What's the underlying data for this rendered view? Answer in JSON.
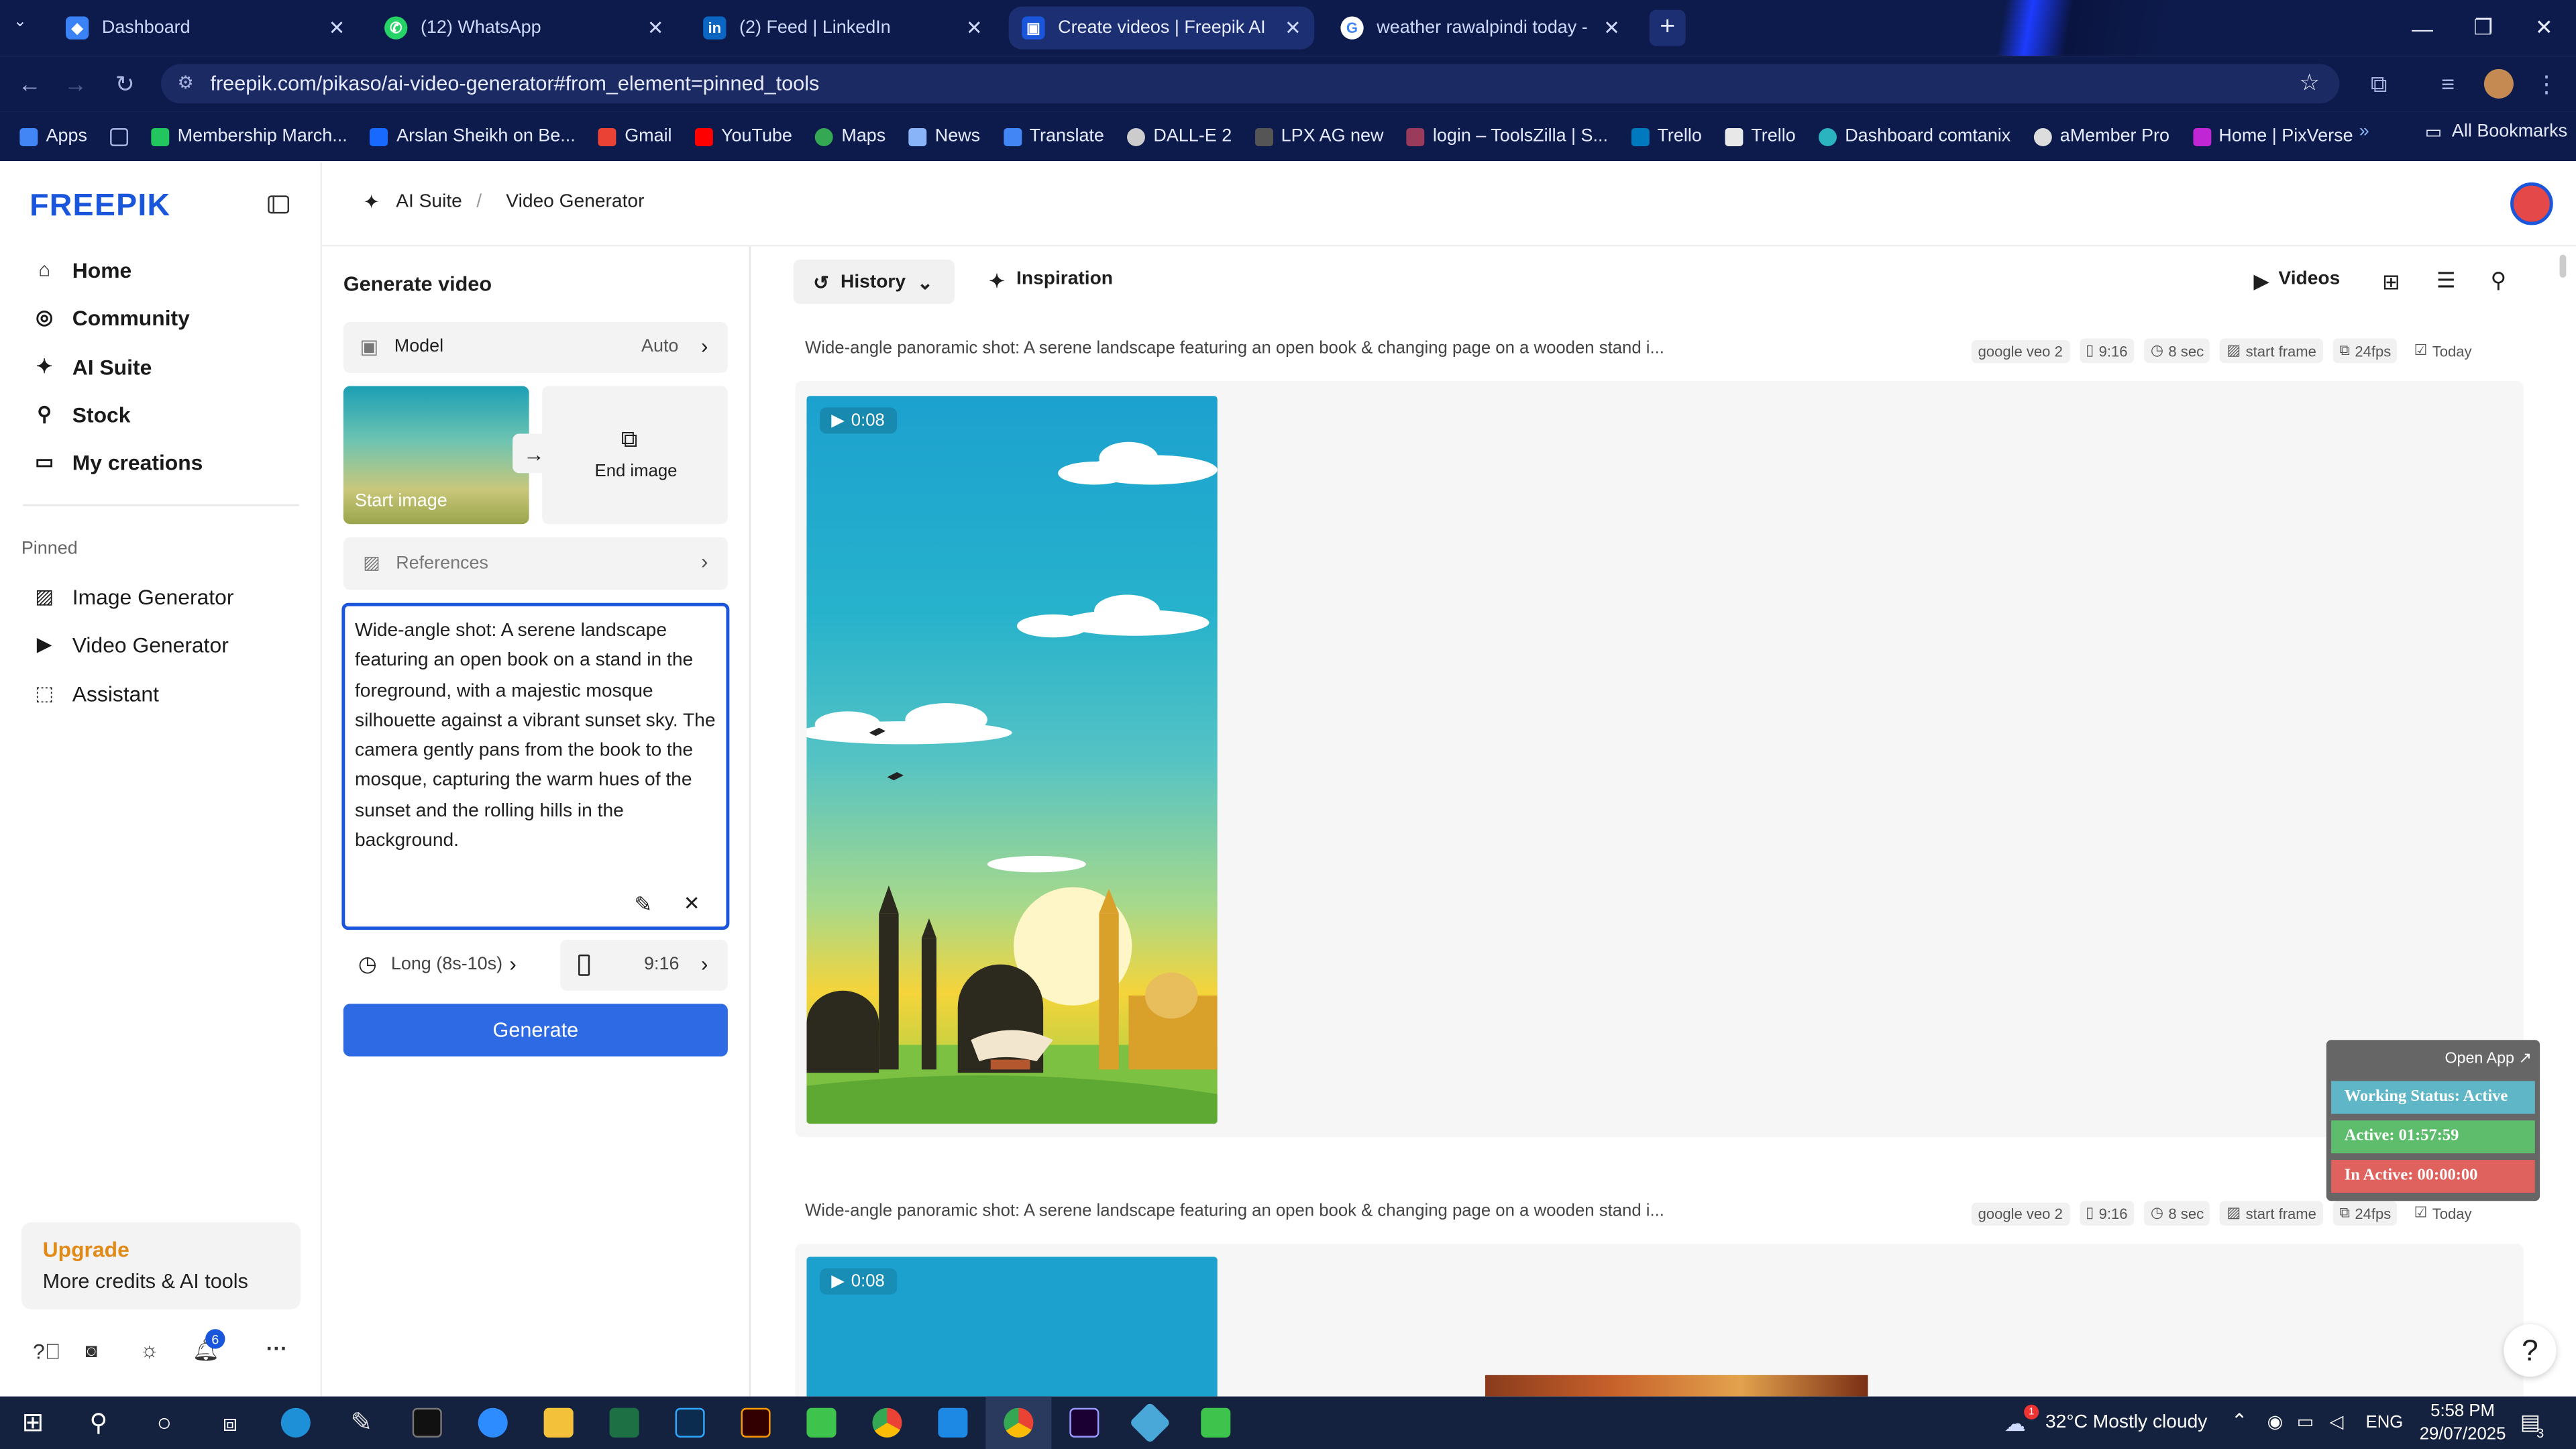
{
  "browser": {
    "tabs": [
      {
        "title": "Dashboard",
        "color": "#3b82f6"
      },
      {
        "title": "(12) WhatsApp",
        "color": "#25d366"
      },
      {
        "title": "(2) Feed | LinkedIn",
        "color": "#0a66c2"
      },
      {
        "title": "Create videos | Freepik AI",
        "color": "#1a56db"
      },
      {
        "title": "weather rawalpindi today - Goo",
        "color": "#ffffff"
      }
    ],
    "url": "freepik.com/pikaso/ai-video-generator#from_element=pinned_tools",
    "bookmarks": [
      "Apps",
      "Membership March...",
      "Arslan Sheikh on Be...",
      "Gmail",
      "YouTube",
      "Maps",
      "News",
      "Translate",
      "DALL-E 2",
      "LPX AG new",
      "login – ToolsZilla | S...",
      "Trello",
      "Trello",
      "Dashboard comtanix",
      "aMember Pro",
      "Home | PixVerse"
    ],
    "all_bookmarks": "All Bookmarks"
  },
  "header": {
    "logo": "FREEPIK",
    "breadcrumb_1": "AI Suite",
    "breadcrumb_sep": "/",
    "breadcrumb_2": "Video Generator"
  },
  "sidebar": {
    "items": [
      "Home",
      "Community",
      "AI Suite",
      "Stock",
      "My creations"
    ],
    "pinned_label": "Pinned",
    "pinned": [
      "Image Generator",
      "Video Generator",
      "Assistant"
    ],
    "upgrade_title": "Upgrade",
    "upgrade_sub": "More credits & AI tools",
    "notif_count": "6"
  },
  "generator": {
    "title": "Generate video",
    "model_label": "Model",
    "model_value": "Auto",
    "start_image": "Start image",
    "end_image": "End image",
    "references": "References",
    "prompt": "Wide-angle shot: A serene landscape featuring an open book on a stand in the foreground, with a majestic mosque silhouette against a vibrant sunset sky. The camera gently pans from the book to the mosque, capturing the warm hues of the sunset and the rolling hills in the background.",
    "duration": "Long (8s-10s)",
    "ratio": "9:16",
    "generate": "Generate"
  },
  "content": {
    "history": "History",
    "inspiration": "Inspiration",
    "videos": "Videos",
    "entries": [
      {
        "prompt": "Wide-angle panoramic shot: A serene landscape featuring an open book & changing page on a wooden stand i...",
        "model": "google veo 2",
        "ratio": "9:16",
        "length": "8 sec",
        "frame": "start frame",
        "fps": "24fps",
        "date": "Today",
        "duration": "0:08"
      },
      {
        "prompt": "Wide-angle panoramic shot: A serene landscape featuring an open book & changing page on a wooden stand i...",
        "model": "google veo 2",
        "ratio": "9:16",
        "length": "8 sec",
        "frame": "start frame",
        "fps": "24fps",
        "date": "Today",
        "duration": "0:08"
      }
    ]
  },
  "widget": {
    "open_app": "Open App ↗",
    "working": "Working Status: Active",
    "active": "Active: 01:57:59",
    "inactive": "In Active: 00:00:00"
  },
  "taskbar": {
    "weather": "32°C  Mostly cloudy",
    "lang": "ENG",
    "time": "5:58 PM",
    "date": "29/07/2025",
    "notif": "3"
  }
}
